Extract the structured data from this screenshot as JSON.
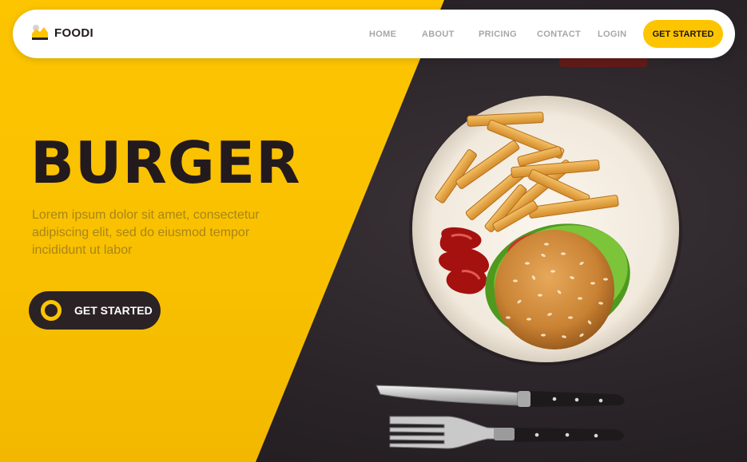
{
  "brand": {
    "name": "FOODI",
    "logo_icon": "chef-hat-icon"
  },
  "nav": {
    "links": [
      "HOME",
      "ABOUT",
      "PRICING",
      "CONTACT",
      "LOGIN"
    ],
    "cta_label": "GET STARTED"
  },
  "hero": {
    "title": "BURGER",
    "description": "Lorem ipsum dolor sit amet, consectetur adipiscing elit, sed do eiusmod tempor incididunt ut labor",
    "cta_label": "GET STARTED"
  },
  "colors": {
    "accent": "#fdc500",
    "dark": "#2a2327",
    "title": "#231a1e",
    "nav_link": "#a7a7a7"
  },
  "image": {
    "subject": "burger-fries-plate-image"
  }
}
